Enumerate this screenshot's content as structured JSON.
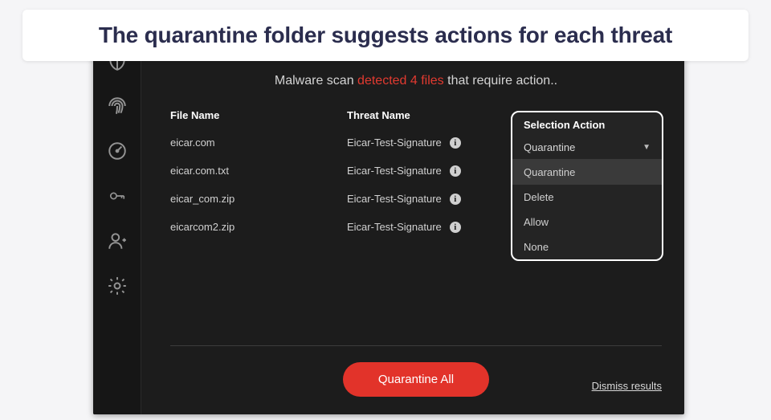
{
  "caption": "The quarantine folder suggests actions for each threat",
  "scan_header": {
    "prefix": "Malware scan ",
    "detected": "detected 4 files",
    "suffix": " that require action.."
  },
  "columns": {
    "file": "File Name",
    "threat": "Threat Name",
    "action": "Selection Action"
  },
  "rows": [
    {
      "file": "eicar.com",
      "threat": "Eicar-Test-Signature"
    },
    {
      "file": "eicar.com.txt",
      "threat": "Eicar-Test-Signature"
    },
    {
      "file": "eicar_com.zip",
      "threat": "Eicar-Test-Signature"
    },
    {
      "file": "eicarcom2.zip",
      "threat": "Eicar-Test-Signature"
    }
  ],
  "dropdown": {
    "selected": "Quarantine",
    "options": [
      "Quarantine",
      "Delete",
      "Allow",
      "None"
    ]
  },
  "footer": {
    "button": "Quarantine All",
    "dismiss": "Dismiss results"
  },
  "sidebar_icons": [
    "shield-icon",
    "fingerprint-icon",
    "gauge-icon",
    "key-icon",
    "add-user-icon",
    "gear-icon"
  ]
}
